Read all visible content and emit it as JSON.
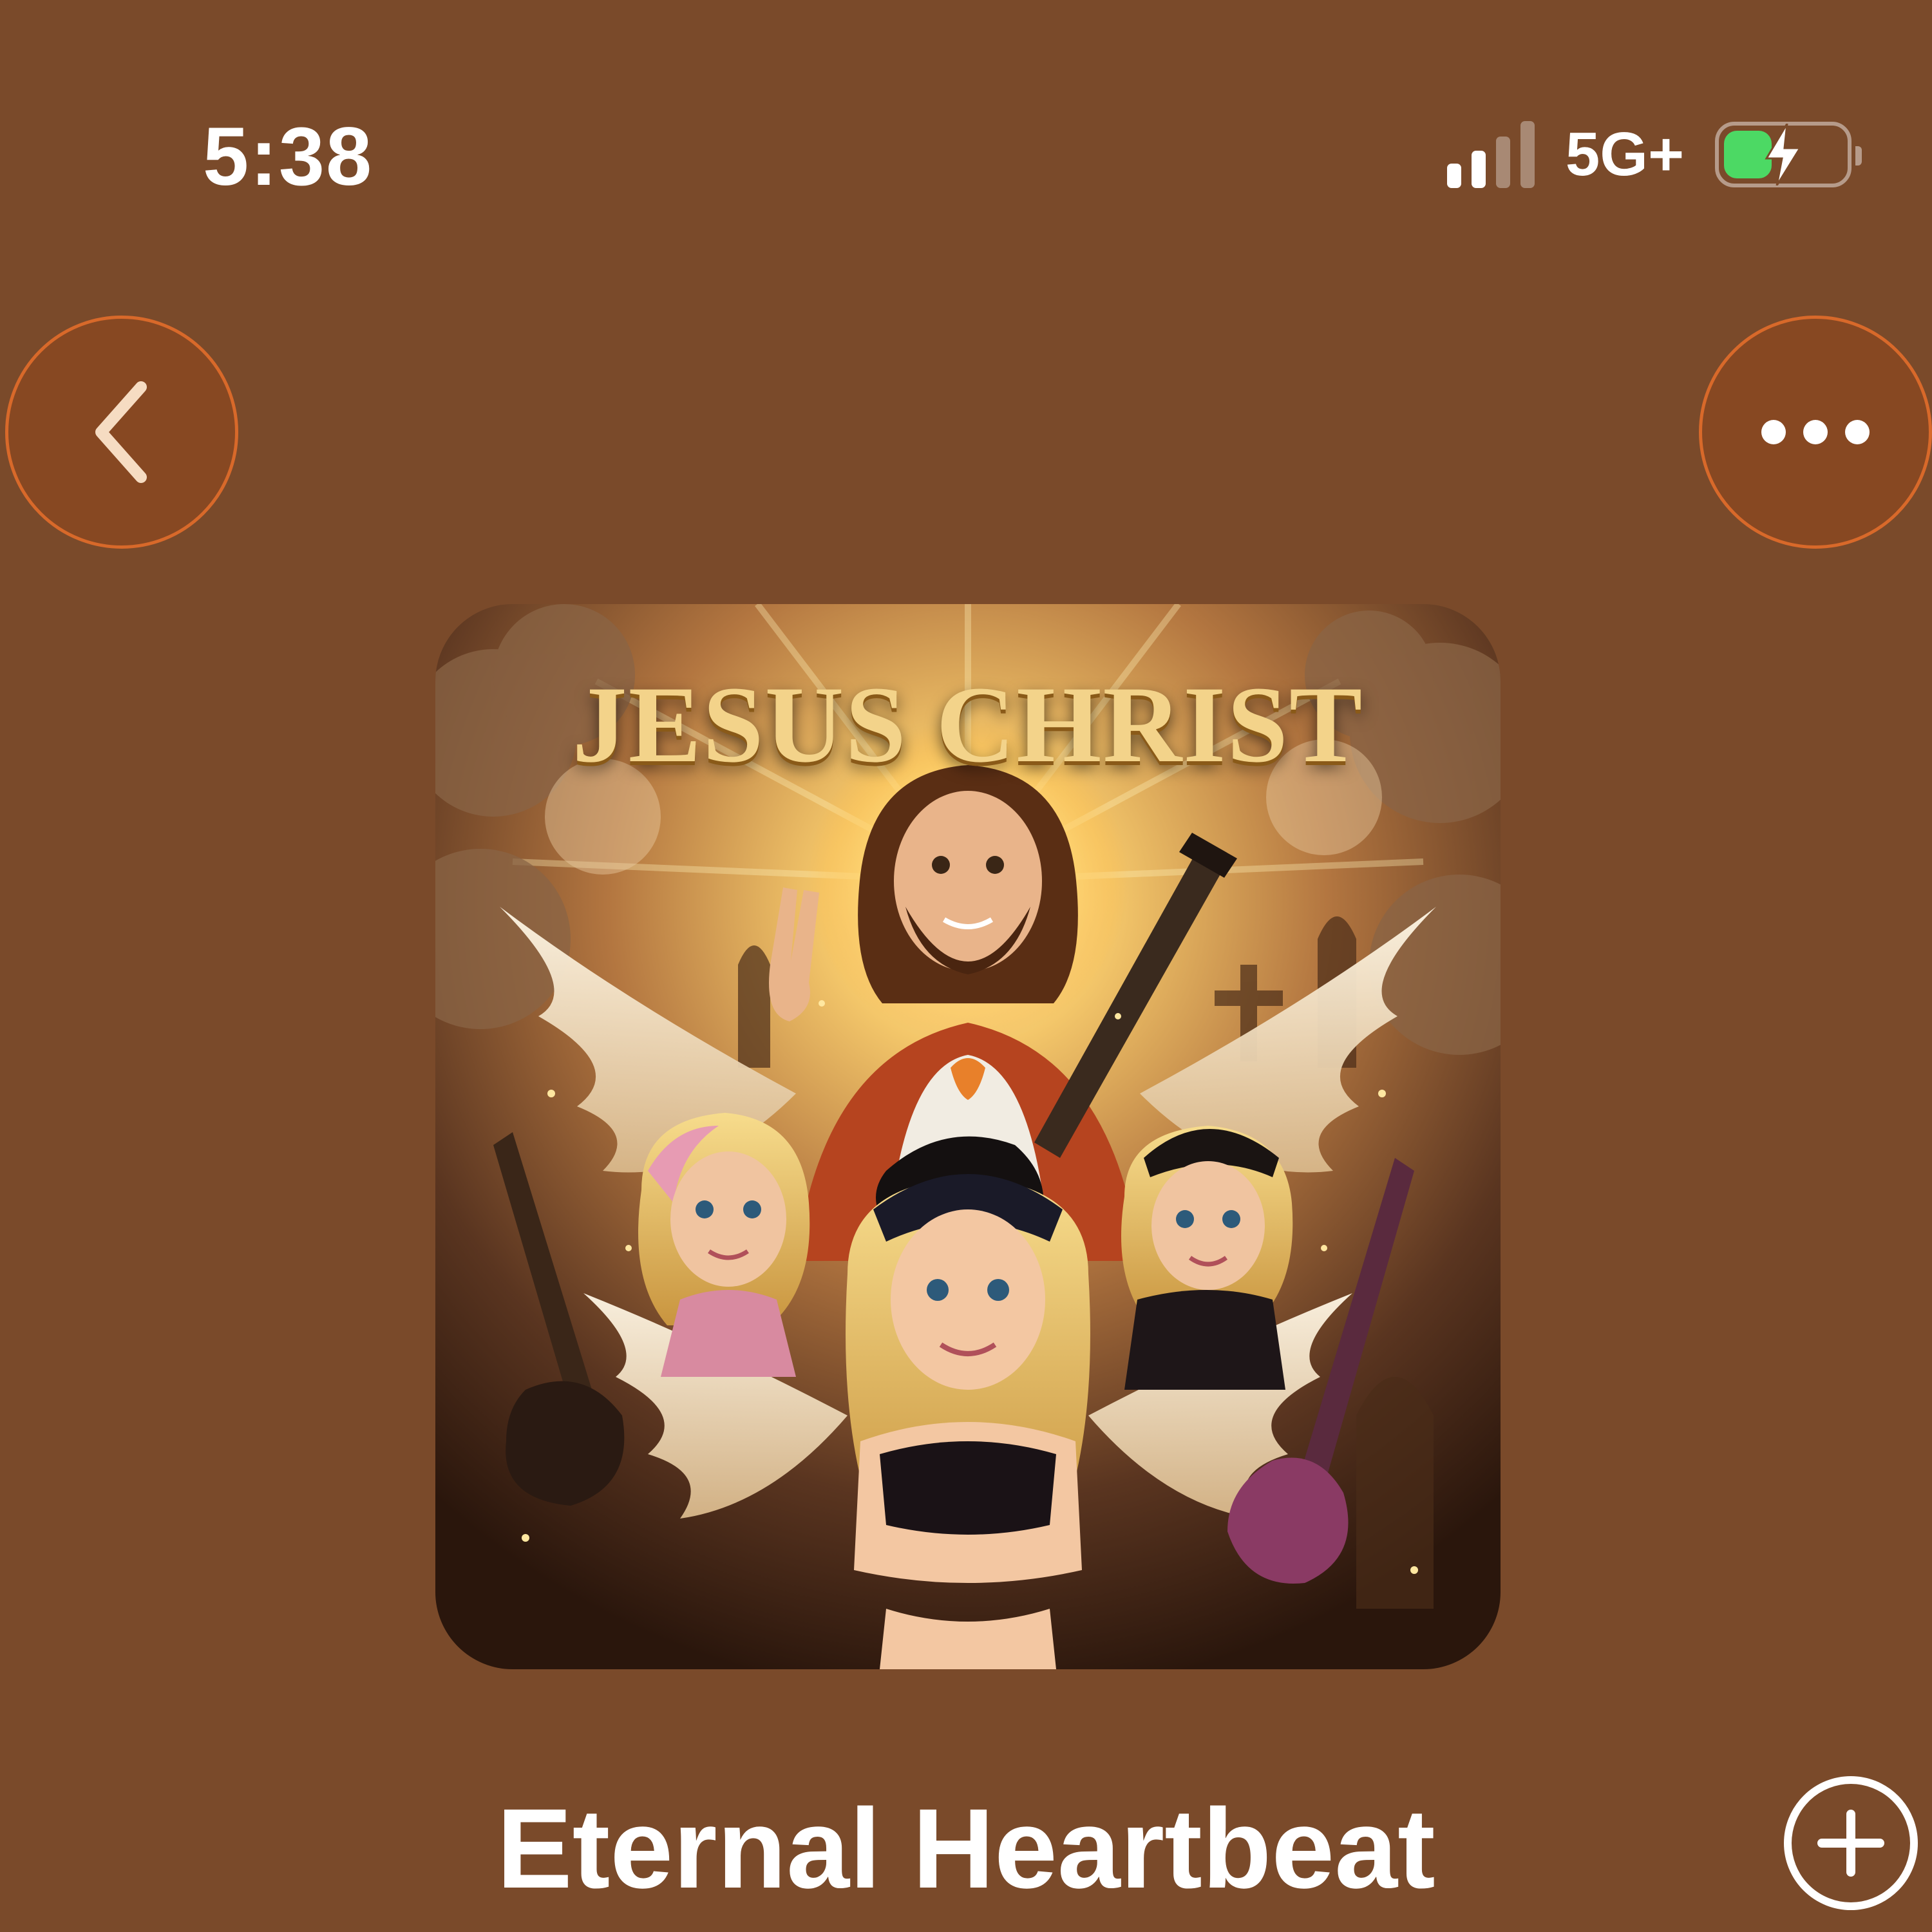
{
  "status_bar": {
    "time": "5:38",
    "network": "5G+",
    "signal_bars_active": 2,
    "signal_bars_total": 4,
    "battery_level": 0.4,
    "battery_charging": true,
    "battery_color": "#4cd964"
  },
  "nav": {
    "back_icon": "chevron-left-icon",
    "more_icon": "more-horizontal-icon"
  },
  "album_art": {
    "title_text": "JESUS CHRIST"
  },
  "song": {
    "title": "Eternal Heartbeat",
    "add_icon": "plus-circle-icon"
  },
  "colors": {
    "background": "#7a4a2a",
    "button_fill": "#874822",
    "button_border": "#d8692a",
    "chevron": "#f6dcc2"
  }
}
